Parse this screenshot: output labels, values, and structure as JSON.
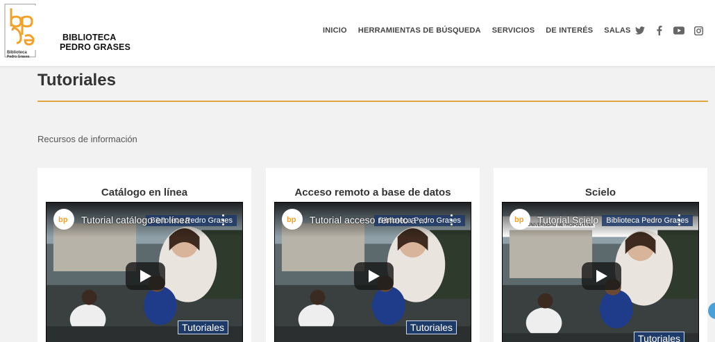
{
  "header": {
    "brand_line1": "BIBLIOTECA",
    "brand_line2": "PEDRO GRASES",
    "logo_text": "bpg",
    "logo_caption": "Biblioteca Pedro Grases",
    "nav": [
      {
        "label": "INICIO"
      },
      {
        "label": "HERRAMIENTAS DE BÚSQUEDA"
      },
      {
        "label": "SERVICIOS"
      },
      {
        "label": "DE INTERÉS"
      },
      {
        "label": "SALAS"
      }
    ],
    "social": [
      "twitter-icon",
      "facebook-icon",
      "youtube-icon",
      "instagram-icon"
    ]
  },
  "page": {
    "title": "Tutoriales",
    "subtitle": "Recursos de información"
  },
  "cards": [
    {
      "heading": "Catálogo en línea",
      "video_title": "Tutorial catálogo en línea",
      "channel": "Biblioteca Pedro Grases",
      "badge": "Tutoriales"
    },
    {
      "heading": "Acceso remoto a base de datos",
      "video_title": "Tutorial acceso remoto a ...",
      "channel": "Biblioteca Pedro Grases",
      "badge": "Tutoriales"
    },
    {
      "heading": "Scielo",
      "video_title": "Tutorial Scielo",
      "channel": "Biblioteca Pedro Grases",
      "badge": "Tutoriales",
      "metro": "UNIVERSIDAD METROPOLITANA"
    }
  ],
  "colors": {
    "accent": "#e0a640",
    "logo_orange": "#f2a22a",
    "badge_blue": "#1e3a68"
  }
}
